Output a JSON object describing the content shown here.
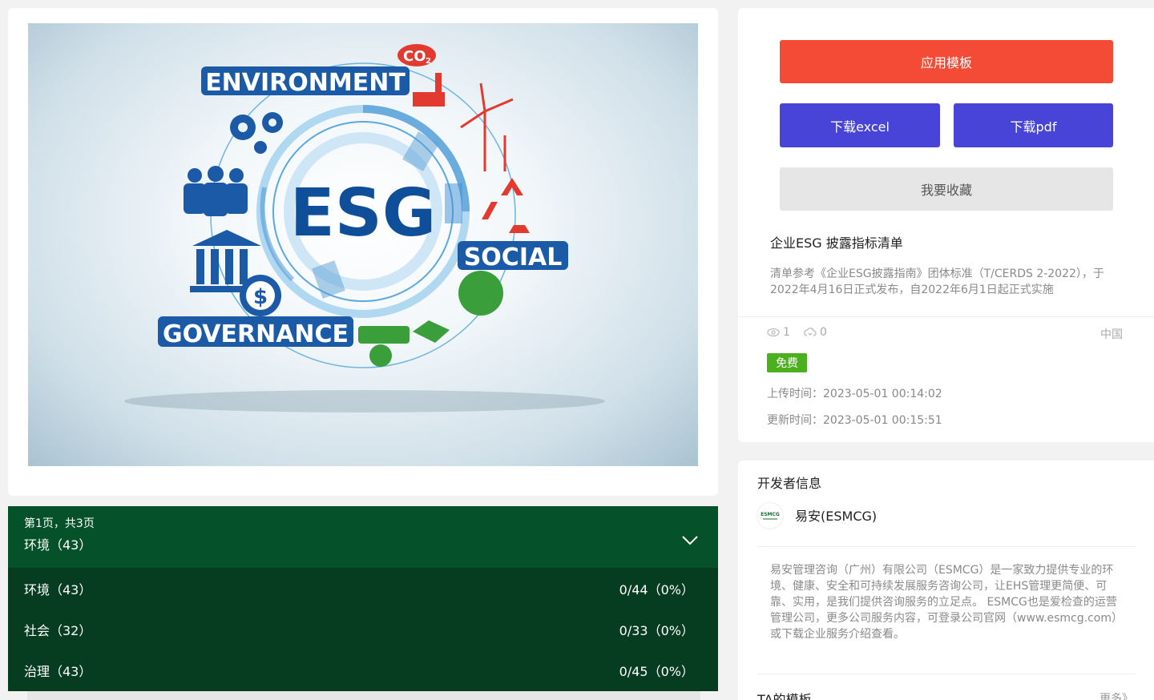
{
  "hero": {
    "labels": {
      "environment": "ENVIRONMENT",
      "esg": "ESG",
      "social": "SOCIAL",
      "governance": "GOVERNANCE",
      "co2": "CO"
    },
    "colors": {
      "blue": "#1a5aa6",
      "red": "#e23a2f",
      "green": "#3a9f3a"
    }
  },
  "toc": {
    "page_info": "第1页，共3页",
    "current": "环境（43）",
    "rows": [
      {
        "label": "环境（43）",
        "progress": "0/44（0%）"
      },
      {
        "label": "社会（32）",
        "progress": "0/33（0%）"
      },
      {
        "label": "治理（43）",
        "progress": "0/45（0%）"
      }
    ],
    "colors": {
      "header": "#055129",
      "body": "#063d21"
    }
  },
  "actions": {
    "apply": "应用模板",
    "download_excel": "下载excel",
    "download_pdf": "下载pdf",
    "favorite": "我要收藏",
    "colors": {
      "apply": "#f44b36",
      "download": "#4844d8",
      "favorite": "#e6e6e6"
    }
  },
  "template": {
    "title": "企业ESG 披露指标清单",
    "description": "清单参考《企业ESG披露指南》团体标准（T/CERDS 2-2022），于2022年4月16日正式发布，自2022年6月1日起正式实施",
    "views": "1",
    "downloads": "0",
    "country": "中国",
    "badge": "免费",
    "upload_label": "上传时间：",
    "upload_time": "2023-05-01 00:14:02",
    "update_label": "更新时间：",
    "update_time": "2023-05-01 00:15:51"
  },
  "developer": {
    "heading": "开发者信息",
    "logo_text": "ESMCG",
    "name": "易安(ESMCG)",
    "description": "易安管理咨询（广州）有限公司（ESMCG）是一家致力提供专业的环境、健康、安全和可持续发展服务咨询公司，让EHS管理更简便、可靠、实用，是我们提供咨询服务的立足点。 ESMCG也是爱检查的运营管理公司，更多公司服务内容，可登录公司官网（www.esmcg.com）或下载企业服务介绍查看。"
  },
  "ta_templates": {
    "heading": "TA的模板",
    "more": "更多》"
  }
}
